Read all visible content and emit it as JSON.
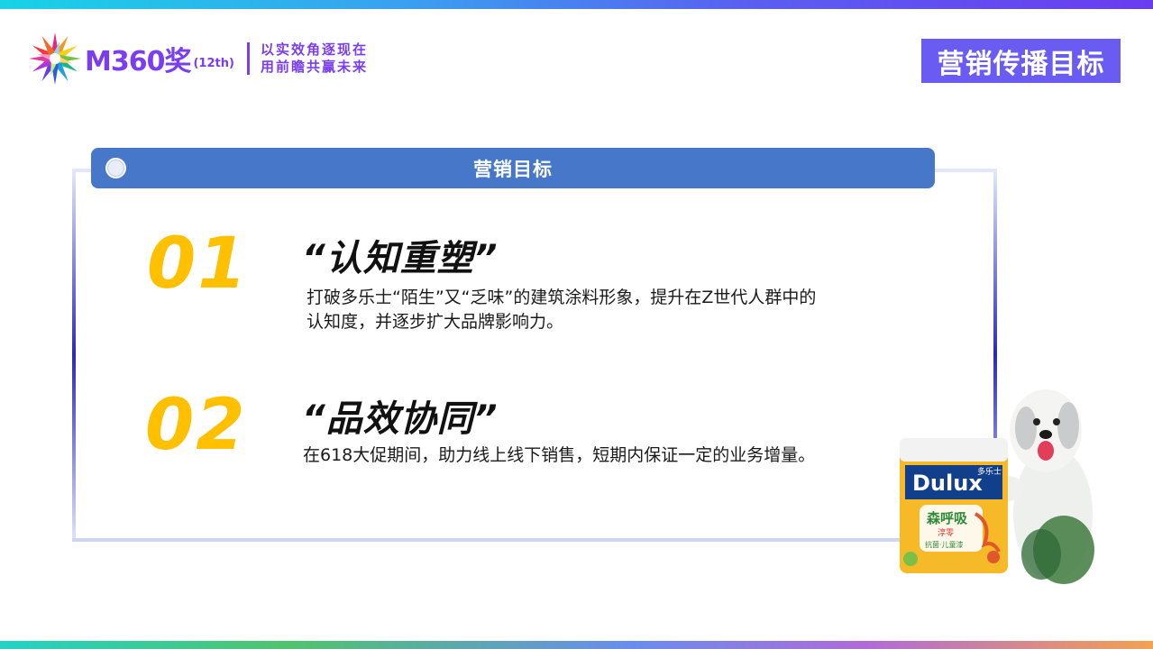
{
  "header": {
    "logo": {
      "brand": "M360奖",
      "edition": "(12th)",
      "slogan_line1": "以实效角逐现在",
      "slogan_line2": "用前瞻共赢未来"
    },
    "page_title": "营销传播目标"
  },
  "section": {
    "title": "营销目标"
  },
  "goals": [
    {
      "number": "01",
      "title": "“认知重塑”",
      "description": "打破多乐士“陌生”又“乏味”的建筑涂料形象，提升在Z世代人群中的认知度，并逐步扩大品牌影响力。"
    },
    {
      "number": "02",
      "title": "“品效协同”",
      "description": "在618大促期间，助力线上线下销售，短期内保证一定的业务增量。"
    }
  ],
  "product_image": {
    "brand_text": "Dulux",
    "brand_cn": "多乐士",
    "product_name": "森呼吸",
    "product_sub": "淳零",
    "product_tag": "抗菌·儿童漆"
  },
  "colors": {
    "accent_purple": "#6a5cf2",
    "header_blue": "#4677c9",
    "number_yellow": "#ffc000",
    "logo_purple": "#7a3df0"
  }
}
